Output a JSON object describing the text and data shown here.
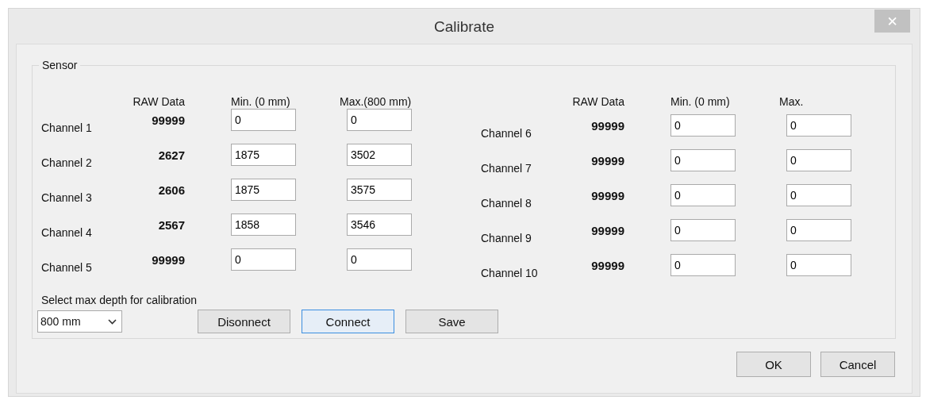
{
  "window": {
    "title": "Calibrate",
    "close_glyph": "✕"
  },
  "sensor": {
    "title": "Sensor",
    "panels": [
      {
        "headers": [
          "RAW Data",
          "Min. (0 mm)",
          "Max.(800 mm)"
        ],
        "channels": [
          {
            "name": "Channel 1",
            "raw": "99999",
            "min": "0",
            "max": "0"
          },
          {
            "name": "Channel 2",
            "raw": "2627",
            "min": "1875",
            "max": "3502"
          },
          {
            "name": "Channel 3",
            "raw": "2606",
            "min": "1875",
            "max": "3575"
          },
          {
            "name": "Channel 4",
            "raw": "2567",
            "min": "1858",
            "max": "3546"
          },
          {
            "name": "Channel 5",
            "raw": "99999",
            "min": "0",
            "max": "0"
          }
        ]
      },
      {
        "headers": [
          "RAW Data",
          "Min. (0 mm)",
          "Max."
        ],
        "channels": [
          {
            "name": "Channel 6",
            "raw": "99999",
            "min": "0",
            "max": "0"
          },
          {
            "name": "Channel 7",
            "raw": "99999",
            "min": "0",
            "max": "0"
          },
          {
            "name": "Channel 8",
            "raw": "99999",
            "min": "0",
            "max": "0"
          },
          {
            "name": "Channel 9",
            "raw": "99999",
            "min": "0",
            "max": "0"
          },
          {
            "name": "Channel 10",
            "raw": "99999",
            "min": "0",
            "max": "0"
          }
        ]
      }
    ],
    "depth": {
      "label": "Select max depth for calibration",
      "value": "800 mm"
    },
    "buttons": [
      {
        "label": "Disonnect",
        "focused": false
      },
      {
        "label": "Connect",
        "focused": true
      },
      {
        "label": "Save",
        "focused": false
      }
    ]
  },
  "dialog_buttons": [
    {
      "label": "OK",
      "focused": false
    },
    {
      "label": "Cancel",
      "focused": false
    }
  ]
}
